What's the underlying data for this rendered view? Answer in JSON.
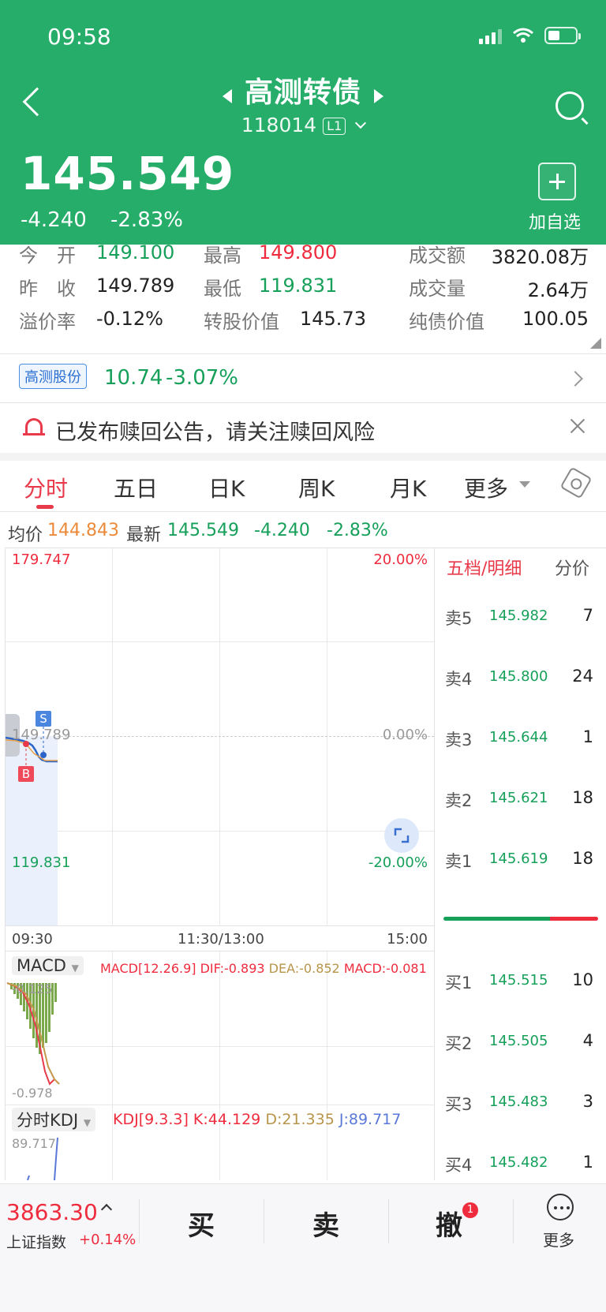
{
  "status_bar": {
    "time": "09:58"
  },
  "header": {
    "title": "高测转债",
    "code": "118014",
    "level": "L1",
    "price": "145.549",
    "change": "-4.240",
    "change_pct": "-2.83%",
    "add_watch": "加自选"
  },
  "quote": {
    "open_label": "今　开",
    "open": "149.100",
    "high_label": "最高",
    "high": "149.800",
    "turnover_label": "成交额",
    "turnover": "3820.08万",
    "prev_close_label": "昨　收",
    "prev_close": "149.789",
    "low_label": "最低",
    "low": "119.831",
    "volume_label": "成交量",
    "volume": "2.64万",
    "premium_label": "溢价率",
    "premium": "-0.12%",
    "conv_value_label": "转股价值",
    "conv_value": "145.73",
    "bond_value_label": "纯债价值",
    "bond_value": "100.05"
  },
  "stock": {
    "name": "高测股份",
    "price": "10.74",
    "change_pct": "-3.07%"
  },
  "notice": {
    "text": "已发布赎回公告，请关注赎回风险"
  },
  "tabs": [
    "分时",
    "五日",
    "日K",
    "周K",
    "月K",
    "更多"
  ],
  "info_bar": {
    "avg_label": "均价",
    "avg": "144.843",
    "latest_label": "最新",
    "latest": "145.549",
    "change": "-4.240",
    "change_pct": "-2.83%"
  },
  "chart": {
    "y_max": "179.747",
    "y_mid": "149.789",
    "y_min": "119.831",
    "pct_max": "20.00%",
    "pct_mid": "0.00%",
    "pct_min": "-20.00%",
    "x_start": "09:30",
    "x_mid": "11:30/13:00",
    "x_end": "15:00",
    "marker_s": "S",
    "marker_b": "B",
    "macd_selector": "MACD",
    "macd_params": "MACD[12.26.9]",
    "dif": "DIF:-0.893",
    "dea": "DEA:-0.852",
    "macd": "MACD:-0.081",
    "macd_top": "-0.125",
    "macd_bottom": "-0.978",
    "kdj_selector": "分时KDJ",
    "kdj_params": "KDJ[9.3.3]",
    "k": "K:44.129",
    "d": "D:21.335",
    "j": "J:89.717",
    "kdj_top": "89.717"
  },
  "orderbook": {
    "tab_active": "五档/明细",
    "tab_other": "分价",
    "asks": [
      {
        "label": "卖5",
        "price": "145.982",
        "vol": "7"
      },
      {
        "label": "卖4",
        "price": "145.800",
        "vol": "24"
      },
      {
        "label": "卖3",
        "price": "145.644",
        "vol": "1"
      },
      {
        "label": "卖2",
        "price": "145.621",
        "vol": "18"
      },
      {
        "label": "卖1",
        "price": "145.619",
        "vol": "18"
      }
    ],
    "bids": [
      {
        "label": "买1",
        "price": "145.515",
        "vol": "10"
      },
      {
        "label": "买2",
        "price": "145.505",
        "vol": "4"
      },
      {
        "label": "买3",
        "price": "145.483",
        "vol": "3"
      },
      {
        "label": "买4",
        "price": "145.482",
        "vol": "1"
      }
    ],
    "sell_ratio": 0.69
  },
  "bottom": {
    "index_value": "3863.30",
    "index_name": "上证指数",
    "index_change": "+0.14%",
    "buy": "买",
    "sell": "卖",
    "cancel": "撤",
    "cancel_badge": "1",
    "more": "更多"
  },
  "colors": {
    "brand_green": "#25ad69",
    "down": "#16a05a",
    "up": "#ee2c3e"
  }
}
